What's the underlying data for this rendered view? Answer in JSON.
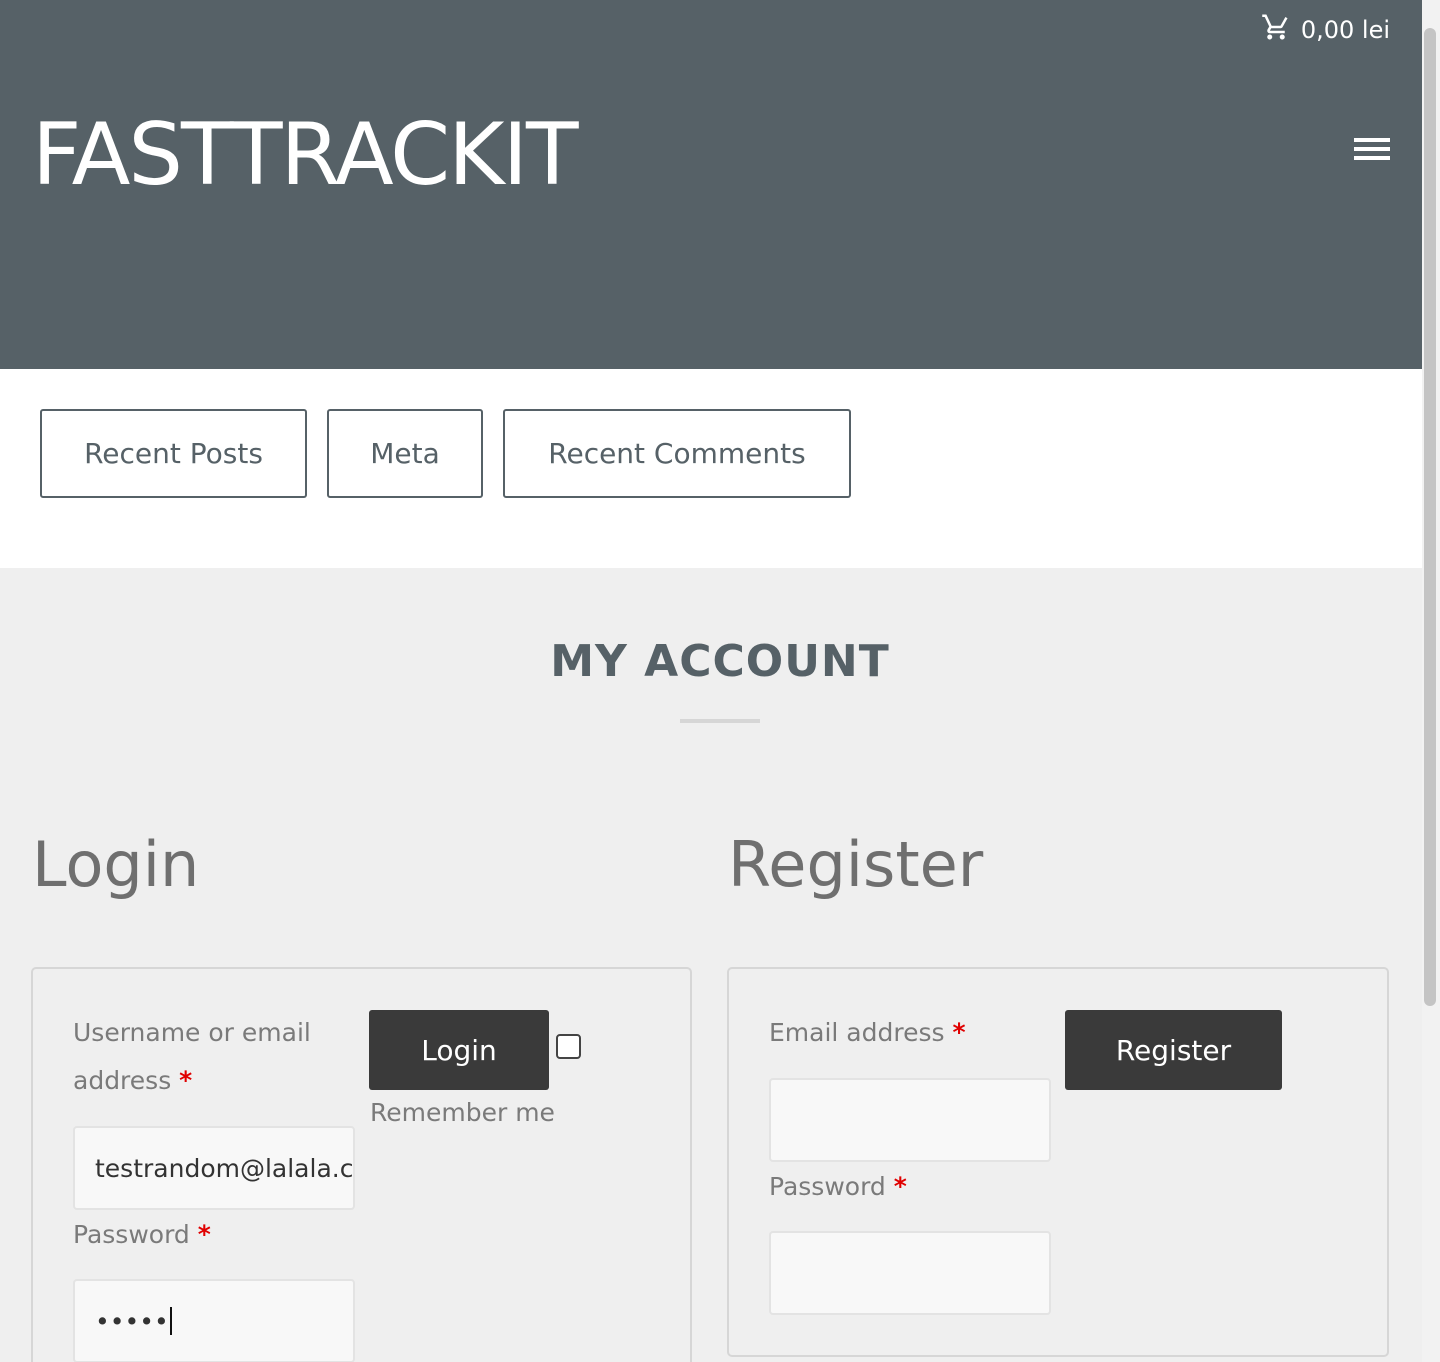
{
  "header": {
    "cart_total": "0,00 lei",
    "site_title": "FASTTRACKIT",
    "background_color": "#566167"
  },
  "widgets": {
    "tabs": [
      {
        "label": "Recent Posts"
      },
      {
        "label": "Meta"
      },
      {
        "label": "Recent Comments"
      }
    ]
  },
  "page": {
    "title": "MY ACCOUNT"
  },
  "login": {
    "heading": "Login",
    "username_label": "Username or email address",
    "required_mark": "*",
    "username_value": "testrandom@lalala.com",
    "password_label": "Password",
    "password_masked": "•••••",
    "submit_label": "Login",
    "remember_label": "Remember me",
    "remember_checked": false
  },
  "register": {
    "heading": "Register",
    "email_label": "Email address",
    "required_mark": "*",
    "email_value": "",
    "password_label": "Password",
    "password_value": "",
    "submit_label": "Register"
  },
  "colors": {
    "accent_dark": "#3a3a3a",
    "required": "#e00000",
    "page_bg": "#efefef"
  }
}
